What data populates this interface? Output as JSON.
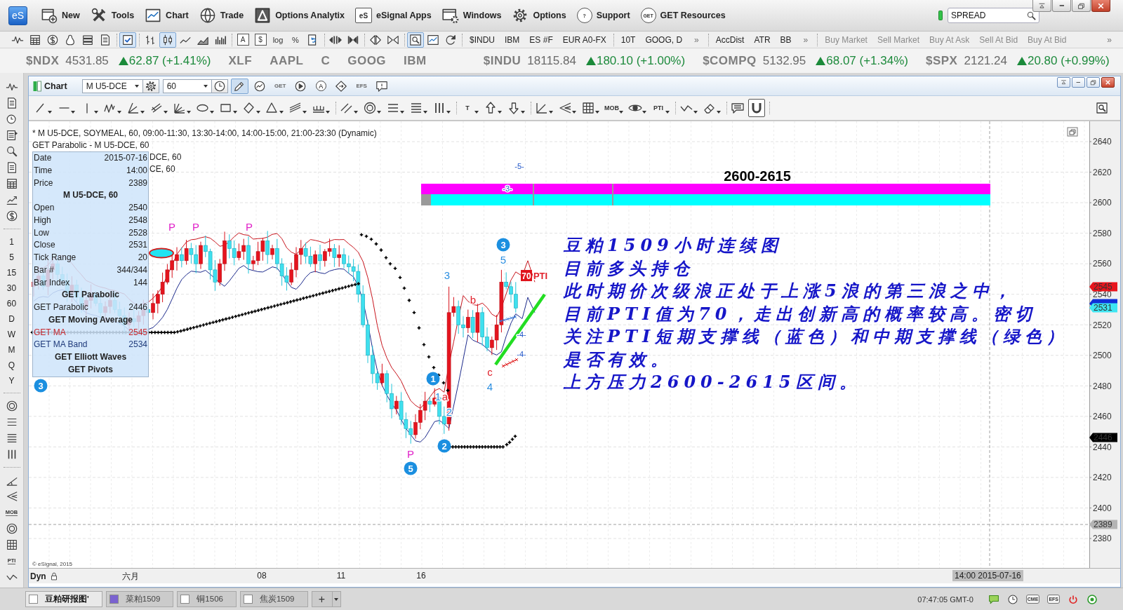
{
  "menu_bar": {
    "logo": "eS",
    "items": [
      {
        "kind": "new",
        "label": "New"
      },
      {
        "kind": "tools",
        "label": "Tools"
      },
      {
        "kind": "chart",
        "label": "Chart"
      },
      {
        "kind": "trade",
        "label": "Trade"
      },
      {
        "kind": "analytix",
        "label": "Options Analytix"
      },
      {
        "kind": "apps",
        "label": "eSignal Apps",
        "icon_text": "eS"
      },
      {
        "kind": "windows",
        "label": "Windows"
      },
      {
        "kind": "options",
        "label": "Options"
      },
      {
        "kind": "support",
        "label": "Support",
        "icon_text": "?"
      },
      {
        "kind": "resources",
        "label": "GET Resources",
        "icon_text": "GET"
      }
    ],
    "search": {
      "value": "SPREAD"
    }
  },
  "toolbar": {
    "button_groups": [
      [
        {
          "kind": "pulse",
          "selected": false
        },
        {
          "kind": "table",
          "selected": false
        },
        {
          "kind": "coin",
          "selected": false
        },
        {
          "kind": "bell",
          "selected": false
        },
        {
          "kind": "stack",
          "selected": false
        },
        {
          "kind": "document",
          "selected": false
        }
      ],
      [
        {
          "kind": "checklist",
          "selected": true
        }
      ],
      [
        {
          "kind": "ohlc",
          "selected": false
        },
        {
          "kind": "candles",
          "selected": true
        },
        {
          "kind": "linechart",
          "selected": false
        },
        {
          "kind": "area",
          "selected": false
        },
        {
          "kind": "histogram",
          "selected": false
        }
      ],
      [
        {
          "kind": "boxed",
          "label": "A",
          "selected": false
        },
        {
          "kind": "boxed",
          "label": "$",
          "selected": false
        },
        {
          "kind": "text",
          "label": "log",
          "selected": false
        },
        {
          "kind": "text",
          "label": "%",
          "selected": false
        },
        {
          "kind": "refreshdoc",
          "selected": false
        }
      ],
      [
        {
          "kind": "expand",
          "selected": false
        },
        {
          "kind": "compress",
          "selected": false
        }
      ],
      [
        {
          "kind": "splitdiamond",
          "selected": false
        },
        {
          "kind": "bowtie",
          "selected": false
        }
      ],
      [
        {
          "kind": "zoombox",
          "selected": true
        },
        {
          "kind": "chartwin",
          "selected": false
        },
        {
          "kind": "refresh",
          "selected": false
        }
      ]
    ],
    "link_groups": [
      {
        "links": [
          "$INDU",
          "IBM",
          "ES #F",
          "EUR A0-FX"
        ],
        "disabled": false
      },
      {
        "links": [
          "10T",
          "GOOG, D"
        ],
        "more": "»",
        "disabled": false
      },
      {
        "links": [
          "AccDist",
          "ATR",
          "BB"
        ],
        "more": "»",
        "disabled": false
      },
      {
        "links": [
          "Buy Market",
          "Sell Market",
          "Buy At Ask",
          "Sell At Bid",
          "Buy At Bid"
        ],
        "more": "»",
        "disabled": true
      }
    ]
  },
  "ticker": [
    {
      "symbol": "$NDX",
      "price": "4531.85",
      "up": true,
      "change": "62.87 (+1.41%)"
    },
    {
      "symbol": "XLF"
    },
    {
      "symbol": "AAPL"
    },
    {
      "symbol": "C"
    },
    {
      "symbol": "GOOG"
    },
    {
      "symbol": "IBM"
    },
    {
      "symbol": "$INDU",
      "price": "18115.84",
      "up": true,
      "change": "180.10 (+1.00%)"
    },
    {
      "symbol": "$COMPQ",
      "price": "5132.95",
      "up": true,
      "change": "68.07 (+1.34%)"
    },
    {
      "symbol": "$SPX",
      "price": "2121.24",
      "up": true,
      "change": "20.80 (+0.99%)"
    }
  ],
  "left_toolbar": {
    "top_buttons": [
      {
        "kind": "pulse"
      },
      {
        "kind": "document"
      },
      {
        "kind": "clockdollar"
      },
      {
        "kind": "list"
      },
      {
        "kind": "zoom"
      },
      {
        "kind": "document"
      },
      {
        "kind": "table"
      },
      {
        "kind": "trendup"
      },
      {
        "kind": "coin"
      }
    ],
    "intervals": [
      "1",
      "5",
      "15",
      "30",
      "60",
      "D",
      "W",
      "M",
      "Q",
      "Y"
    ],
    "middle_buttons": [
      {
        "kind": "target"
      },
      {
        "kind": "lines3"
      },
      {
        "kind": "lines4"
      },
      {
        "kind": "bars3"
      }
    ],
    "bottom_buttons": [
      {
        "kind": "trendchart"
      },
      {
        "kind": "arrowsleft"
      },
      {
        "kind": "text",
        "label": "MOB"
      },
      {
        "kind": "target"
      },
      {
        "kind": "grid"
      },
      {
        "kind": "text",
        "label": "PTI"
      },
      {
        "kind": "zigzag2"
      }
    ]
  },
  "chart_window": {
    "title": "Chart",
    "symbol": "M U5-DCE",
    "interval": "60",
    "tools": [
      {
        "kind": "pencil",
        "selected": true
      },
      {
        "kind": "chartcircle",
        "selected": false
      },
      {
        "kind": "text",
        "label": "GET",
        "selected": false
      },
      {
        "kind": "play",
        "selected": false
      },
      {
        "kind": "circled",
        "label": "A",
        "selected": false
      },
      {
        "kind": "tag",
        "selected": false
      },
      {
        "kind": "text",
        "label": "EFS",
        "selected": false
      },
      {
        "kind": "comment",
        "selected": false
      }
    ],
    "drawing_tools": [
      [
        {
          "kind": "line",
          "selected": false
        },
        {
          "kind": "hline",
          "selected": false
        },
        {
          "kind": "vline",
          "selected": false
        },
        {
          "kind": "zigzag",
          "selected": false
        },
        {
          "kind": "fan",
          "selected": false
        },
        {
          "kind": "crossfan",
          "selected": false
        },
        {
          "kind": "gann",
          "selected": false
        },
        {
          "kind": "ellipse",
          "selected": false
        },
        {
          "kind": "rect",
          "selected": false
        },
        {
          "kind": "diamond",
          "selected": false
        },
        {
          "kind": "triangle",
          "selected": false
        },
        {
          "kind": "channel",
          "selected": false
        },
        {
          "kind": "fork",
          "selected": false
        }
      ],
      [
        {
          "kind": "parallel",
          "selected": false
        },
        {
          "kind": "target",
          "selected": false
        },
        {
          "kind": "lines3",
          "selected": false
        },
        {
          "kind": "lines4",
          "selected": false
        },
        {
          "kind": "bars3",
          "selected": false
        }
      ],
      [
        {
          "kind": "text",
          "label": "T",
          "selected": false
        },
        {
          "kind": "arrowup",
          "selected": false
        },
        {
          "kind": "arrowdown",
          "selected": false
        }
      ],
      [
        {
          "kind": "angle",
          "selected": false
        },
        {
          "kind": "arrowsleft",
          "selected": false
        },
        {
          "kind": "grid",
          "selected": false
        },
        {
          "kind": "text",
          "label": "MOB",
          "selected": false
        },
        {
          "kind": "eye",
          "selected": false
        },
        {
          "kind": "text",
          "label": "PTI",
          "selected": false
        }
      ],
      [
        {
          "kind": "zigzag2",
          "selected": false
        },
        {
          "kind": "eraser",
          "selected": false
        }
      ],
      [
        {
          "kind": "stamp",
          "selected": false
        },
        {
          "kind": "magnet",
          "selected": true
        }
      ]
    ]
  },
  "chart": {
    "legend": [
      "* M U5-DCE, SOYMEAL, 60, 09:00-11:30, 13:30-14:00, 14:00-15:00, 21:00-23:30 (Dynamic)",
      "GET Parabolic - M U5-DCE, 60"
    ],
    "legend_fragments": [
      "DCE, 60",
      "CE, 60"
    ],
    "data_window": [
      {
        "kind": "field",
        "label": "Date",
        "value": "2015-07-16"
      },
      {
        "kind": "field",
        "label": "Time",
        "value": "14:00"
      },
      {
        "kind": "field",
        "label": "Price",
        "value": "2389"
      },
      {
        "kind": "header",
        "label": "M U5-DCE, 60"
      },
      {
        "kind": "field",
        "label": "Open",
        "value": "2540"
      },
      {
        "kind": "field",
        "label": "High",
        "value": "2548"
      },
      {
        "kind": "field",
        "label": "Low",
        "value": "2528"
      },
      {
        "kind": "field",
        "label": "Close",
        "value": "2531"
      },
      {
        "kind": "field",
        "label": "Tick Range",
        "value": "20"
      },
      {
        "kind": "field",
        "label": "Bar #",
        "value": "344/344"
      },
      {
        "kind": "field",
        "label": "Bar Index",
        "value": "144"
      },
      {
        "kind": "header",
        "label": "GET Parabolic"
      },
      {
        "kind": "field",
        "label": "GET Parabolic",
        "value": "2446"
      },
      {
        "kind": "header",
        "label": "GET Moving Average"
      },
      {
        "kind": "field",
        "label": "GET MA",
        "value": "2545",
        "color": "#c8282d"
      },
      {
        "kind": "field",
        "label": "GET MA Band",
        "value": "2534",
        "color": "#1f3a7a"
      },
      {
        "kind": "header",
        "label": "GET Elliott Waves"
      },
      {
        "kind": "header",
        "label": "GET Pivots"
      }
    ],
    "zone_label": "2600-2615",
    "labels": [
      {
        "text": "P",
        "kind": "pivot"
      },
      {
        "text": "P",
        "kind": "pivot"
      },
      {
        "text": "P",
        "kind": "pivot"
      },
      {
        "text": "P",
        "kind": "pivot"
      },
      {
        "text": "3",
        "kind": "wave_circle"
      },
      {
        "text": "1",
        "kind": "wave_circle"
      },
      {
        "text": "2",
        "kind": "wave_circle"
      },
      {
        "text": "5",
        "kind": "wave_circle"
      },
      {
        "text": "3",
        "kind": "wave_circle"
      },
      {
        "text": "3",
        "kind": "wave"
      },
      {
        "text": "5",
        "kind": "wave"
      },
      {
        "text": "b",
        "kind": "corrective"
      },
      {
        "text": "c",
        "kind": "corrective"
      },
      {
        "text": "4",
        "kind": "wave"
      },
      {
        "text": "1",
        "kind": "wave"
      },
      {
        "text": "a",
        "kind": "corrective"
      },
      {
        "text": "2",
        "kind": "wave"
      },
      {
        "text": "-5-",
        "kind": "minor"
      },
      {
        "text": "-3-",
        "kind": "minor"
      },
      {
        "text": "-4-",
        "kind": "minor"
      },
      {
        "text": "-4-",
        "kind": "minor"
      },
      {
        "text": "70",
        "kind": "pti_value"
      },
      {
        "text": "PTI",
        "kind": "pti"
      }
    ],
    "annotation": [
      "豆粕1509小时连续图",
      "目前多头持仓",
      "此时期价次级浪正处于上涨5浪的第三浪之中，",
      "目前PTI值为70，走出创新高的概率较高。密切",
      "关注PTI短期支撑线（蓝色）和中期支撑线（绿色）",
      "是否有效。",
      "上方压力2600-2615区间。"
    ],
    "price_axis": [
      "2640",
      "2620",
      "2600",
      "2580",
      "2560",
      "2540",
      "2520",
      "2500",
      "2480",
      "2460",
      "2440",
      "2420",
      "2400",
      "2380"
    ],
    "price_tags": [
      {
        "value": "2545",
        "color": "#e8141c"
      },
      {
        "value": "2531",
        "color": "#3fe6f2"
      },
      {
        "value": "2446",
        "color": "#000000"
      },
      {
        "value": "2389",
        "color": "#b4b4b4"
      }
    ],
    "copyright": "© eSignal, 2015",
    "time_axis": {
      "mode": "Dyn",
      "labels": [
        "六月",
        "08",
        "11",
        "16"
      ],
      "cursor_time": "14:00 2015-07-16"
    }
  },
  "sheet_tabs": [
    {
      "label": "豆粕研报图'",
      "selected": true,
      "color": "#ffffff"
    },
    {
      "label": "菜粕1509",
      "selected": false,
      "color": "#7a62d0"
    },
    {
      "label": "铜1506",
      "selected": false,
      "color": "#ffffff"
    },
    {
      "label": "焦炭1509",
      "selected": false,
      "color": "#ffffff"
    }
  ],
  "tab_controls": {
    "add": "+"
  },
  "status_bar": {
    "time": "07:47:05 GMT-0",
    "icons": [
      {
        "kind": "chat"
      },
      {
        "kind": "clock"
      },
      {
        "kind": "text",
        "label": "CME"
      },
      {
        "kind": "text",
        "label": "EFS"
      },
      {
        "kind": "power"
      },
      {
        "kind": "ring"
      }
    ]
  }
}
